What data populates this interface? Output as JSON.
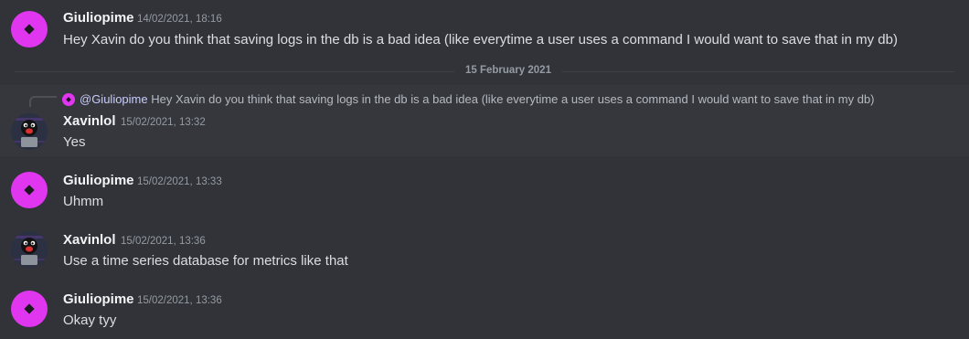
{
  "messages": [
    {
      "author": "Giuliopime",
      "timestamp": "14/02/2021, 18:16",
      "content": "Hey Xavin do you think that saving logs in the db is a bad idea (like everytime a user uses a command I would want to save that in my db)"
    },
    {
      "reply": {
        "mention": "@Giuliopime",
        "text": "Hey Xavin do you think that saving logs in the db is a bad idea (like everytime a user uses a command I would want to save that in my db)"
      },
      "author": "Xavinlol",
      "timestamp": "15/02/2021, 13:32",
      "content": "Yes"
    },
    {
      "author": "Giuliopime",
      "timestamp": "15/02/2021, 13:33",
      "content": "Uhmm"
    },
    {
      "author": "Xavinlol",
      "timestamp": "15/02/2021, 13:36",
      "content": "Use a time series database for metrics like that"
    },
    {
      "author": "Giuliopime",
      "timestamp": "15/02/2021, 13:36",
      "content": "Okay tyy"
    }
  ],
  "date_divider": "15 February 2021",
  "colors": {
    "background": "#313338",
    "highlight": "#35373c",
    "giuliopime_avatar": "#e136f0",
    "username": "#f2f3f5",
    "timestamp": "#949ba4",
    "text": "#dbdee1"
  },
  "icons": {
    "giuliopime_avatar": "magenta-diamond-avatar",
    "xavinlol_avatar": "penguin-avatar"
  }
}
